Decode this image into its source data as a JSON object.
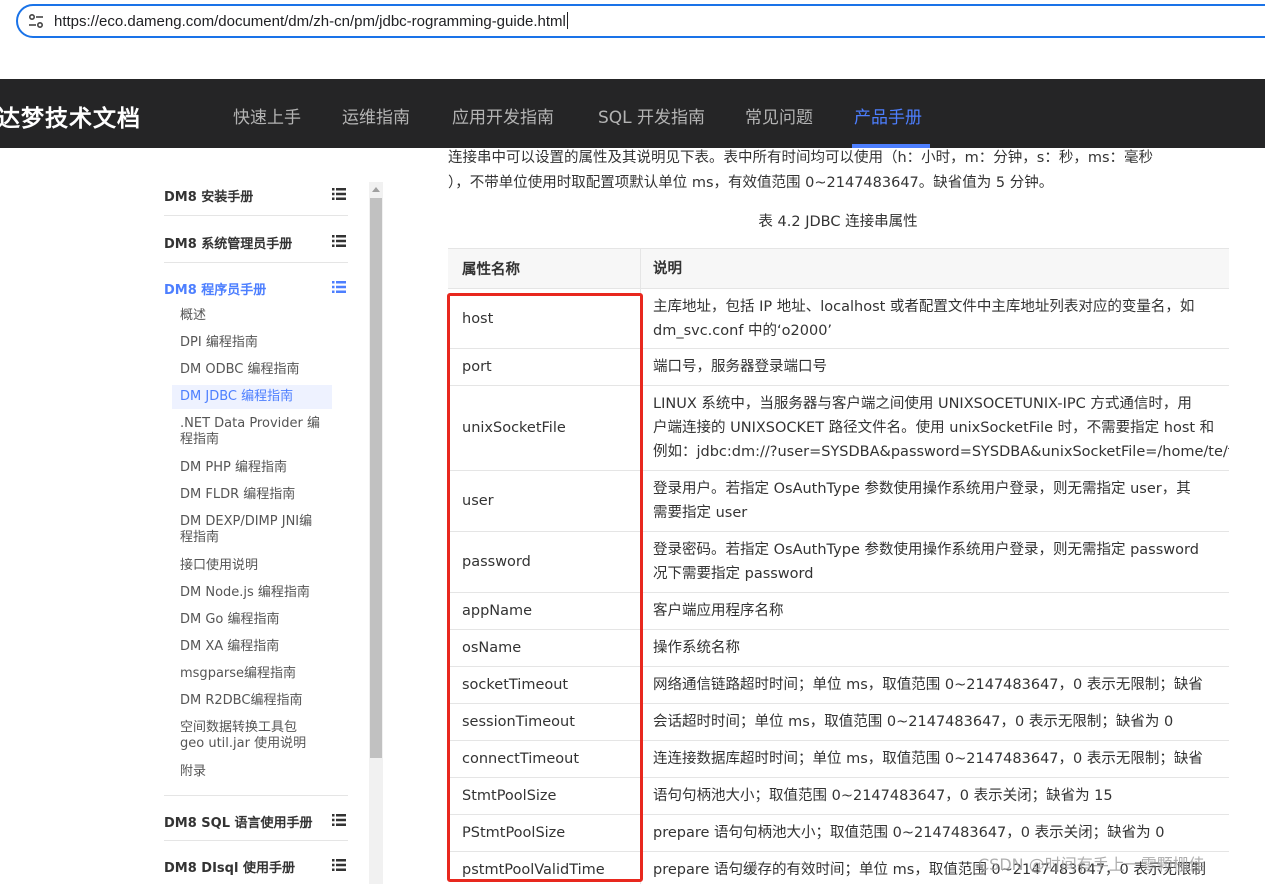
{
  "browser": {
    "url": "https://eco.dameng.com/document/dm/zh-cn/pm/jdbc-rogramming-guide.html",
    "site_info_icon": "tune-icon"
  },
  "header": {
    "site_title": "达梦技术文档",
    "nav": [
      {
        "label": "快速上手",
        "active": false
      },
      {
        "label": "运维指南",
        "active": false
      },
      {
        "label": "应用开发指南",
        "active": false
      },
      {
        "label": "SQL 开发指南",
        "active": false
      },
      {
        "label": "常见问题",
        "active": false
      },
      {
        "label": "产品手册",
        "active": true
      }
    ]
  },
  "sidebar": {
    "sections": [
      {
        "label": "DM8 安装手册"
      },
      {
        "label": "DM8 系统管理员手册"
      },
      {
        "label": "DM8 程序员手册",
        "active": true
      },
      {
        "label": "DM8 SQL 语言使用手册"
      },
      {
        "label": "DM8 DIsql 使用手册"
      }
    ],
    "items": [
      "概述",
      "DPI 编程指南",
      "DM ODBC 编程指南",
      "DM JDBC 编程指南",
      ".NET Data Provider 编程指南",
      "DM PHP 编程指南",
      "DM FLDR 编程指南",
      "DM DEXP/DIMP JNI编程指南",
      "接口使用说明",
      "DM Node.js 编程指南",
      "DM Go 编程指南",
      "DM XA 编程指南",
      "msgparse编程指南",
      "DM R2DBC编程指南",
      "空间数据转换工具包 geo util.jar 使用说明",
      "附录"
    ],
    "active_item": "DM JDBC 编程指南"
  },
  "content": {
    "intro_line1": "连接串中可以设置的属性及其说明见下表。表中所有时间均可以使用（h：小时，m：分钟，s：秒，ms：毫秒",
    "intro_line2": "），不带单位使用时取配置项默认单位 ms，有效值范围 0~2147483647。缺省值为 5 分钟。",
    "table_caption": "表 4.2 JDBC 连接串属性",
    "table": {
      "headers": [
        "属性名称",
        "说明"
      ],
      "rows": [
        {
          "name": "host",
          "desc": [
            "主库地址，包括 IP 地址、localhost 或者配置文件中主库地址列表对应的变量名，如",
            "dm_svc.conf 中的‘o2000’"
          ]
        },
        {
          "name": "port",
          "desc": [
            "端口号，服务器登录端口号"
          ]
        },
        {
          "name": "unixSocketFile",
          "desc": [
            "LINUX 系统中，当服务器与客户端之间使用 UNIXSOCETUNIX-IPC 方式通信时，用",
            "户端连接的 UNIXSOCKET 路径文件名。使用 unixSocketFile 时，不需要指定 host 和",
            "例如：jdbc:dm://?user=SYSDBA&password=SYSDBA&unixSocketFile=/home/te/f"
          ]
        },
        {
          "name": "user",
          "desc": [
            "登录用户。若指定 OsAuthType 参数使用操作系统用户登录，则无需指定 user，其",
            "需要指定 user"
          ]
        },
        {
          "name": "password",
          "desc": [
            "登录密码。若指定 OsAuthType 参数使用操作系统用户登录，则无需指定 password",
            "况下需要指定 password"
          ]
        },
        {
          "name": "appName",
          "desc": [
            "客户端应用程序名称"
          ]
        },
        {
          "name": "osName",
          "desc": [
            "操作系统名称"
          ]
        },
        {
          "name": "socketTimeout",
          "desc": [
            "网络通信链路超时时间；单位 ms，取值范围 0~2147483647，0 表示无限制；缺省"
          ]
        },
        {
          "name": "sessionTimeout",
          "desc": [
            "会话超时时间；单位 ms，取值范围 0~2147483647，0 表示无限制；缺省为 0"
          ]
        },
        {
          "name": "connectTimeout",
          "desc": [
            "连连接数据库超时时间；单位 ms，取值范围 0~2147483647，0 表示无限制；缺省"
          ]
        },
        {
          "name": "StmtPoolSize",
          "desc": [
            "语句句柄池大小；取值范围 0~2147483647，0 表示关闭；缺省为 15"
          ]
        },
        {
          "name": "PStmtPoolSize",
          "desc": [
            "prepare 语句句柄池大小；取值范围 0~2147483647，0 表示关闭；缺省为 0"
          ]
        },
        {
          "name": "pstmtPoolValidTime",
          "desc": [
            "prepare 语句缓存的有效时间；单位 ms，取值范围 0~2147483647，0 表示无限制"
          ]
        }
      ]
    }
  },
  "watermark": "CSDN @时间有手上一零颗栅佳",
  "colors": {
    "accent": "#4d7fff",
    "header_bg": "#252526",
    "highlight": "#e8281e",
    "address_border": "#1a73e8"
  }
}
